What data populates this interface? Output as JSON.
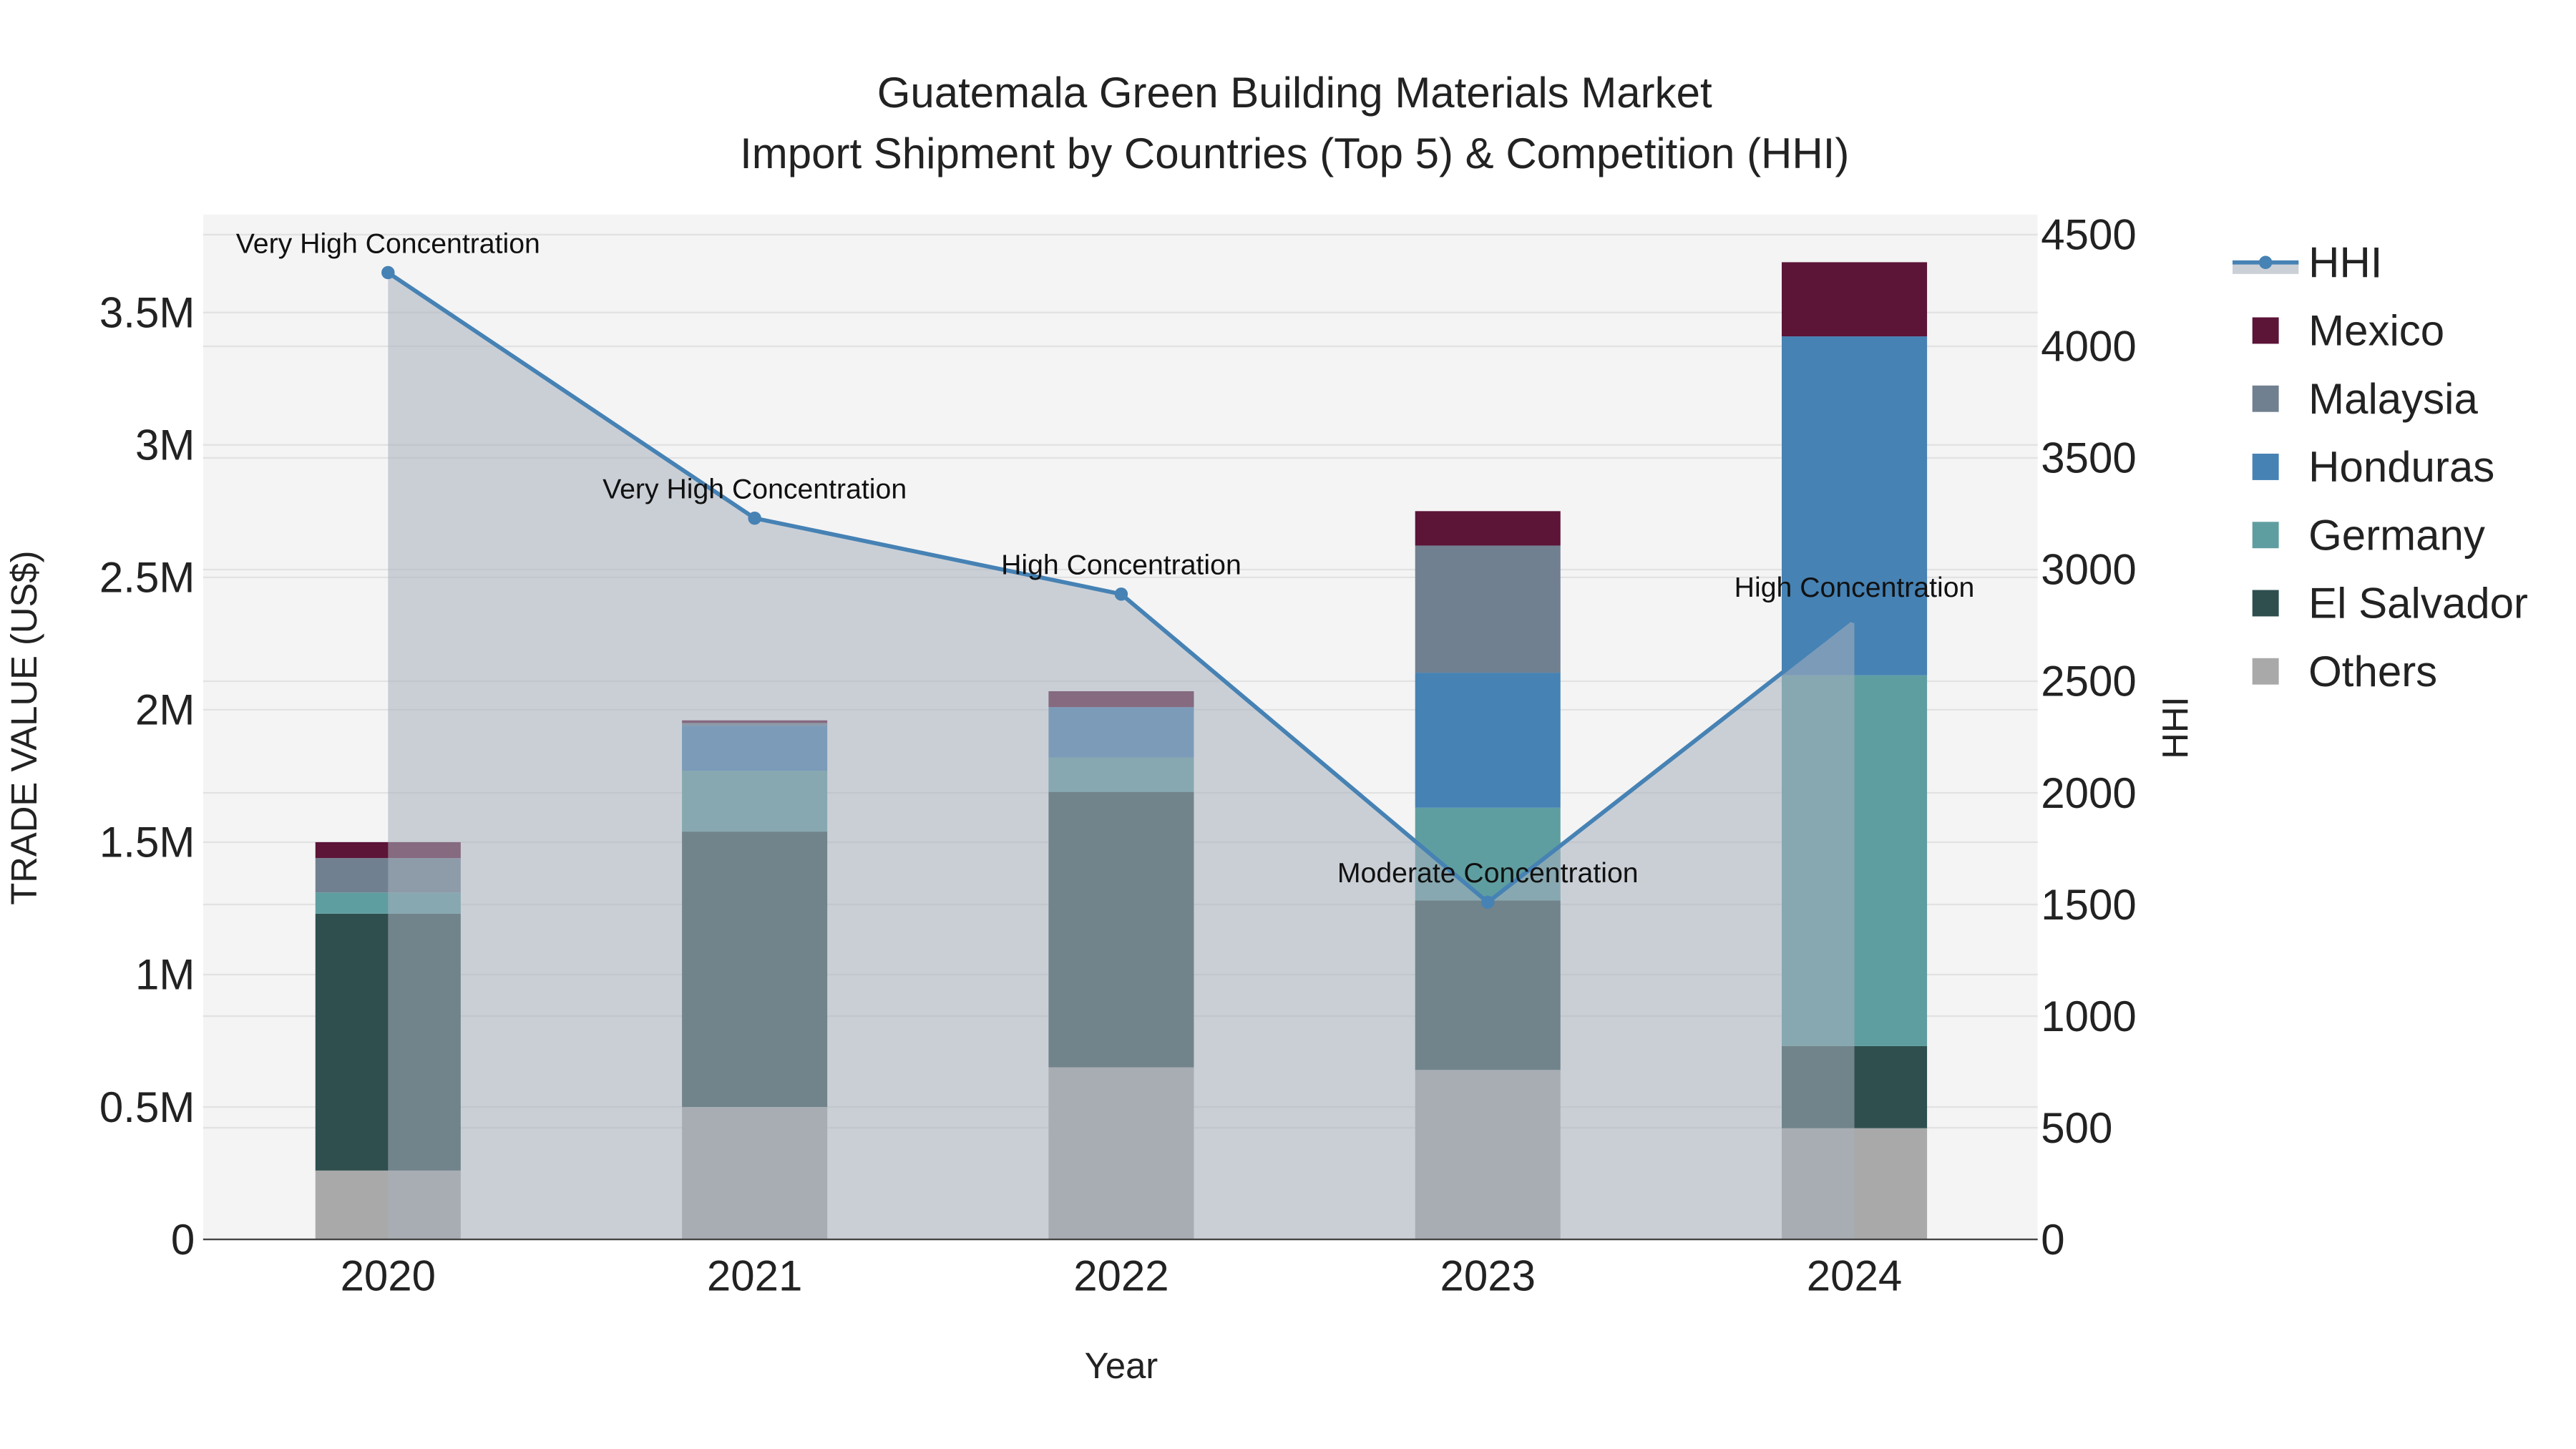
{
  "chart_data": {
    "type": "bar",
    "title": "Guatemala Green Building Materials Market",
    "subtitle": "Import Shipment by Countries (Top 5) & Competition (HHI)",
    "xlabel": "Year",
    "ylabel": "TRADE VALUE (US$)",
    "y2label": "HHI",
    "categories": [
      "2020",
      "2021",
      "2022",
      "2023",
      "2024"
    ],
    "ylim": [
      0,
      3870000
    ],
    "y2lim": [
      0,
      4590
    ],
    "yticks": [
      {
        "v": 0,
        "t": "0"
      },
      {
        "v": 500000,
        "t": "0.5M"
      },
      {
        "v": 1000000,
        "t": "1M"
      },
      {
        "v": 1500000,
        "t": "1.5M"
      },
      {
        "v": 2000000,
        "t": "2M"
      },
      {
        "v": 2500000,
        "t": "2.5M"
      },
      {
        "v": 3000000,
        "t": "3M"
      },
      {
        "v": 3500000,
        "t": "3.5M"
      }
    ],
    "y2ticks": [
      {
        "v": 0,
        "t": "0"
      },
      {
        "v": 500,
        "t": "500"
      },
      {
        "v": 1000,
        "t": "1000"
      },
      {
        "v": 1500,
        "t": "1500"
      },
      {
        "v": 2000,
        "t": "2000"
      },
      {
        "v": 2500,
        "t": "2500"
      },
      {
        "v": 3000,
        "t": "3000"
      },
      {
        "v": 3500,
        "t": "3500"
      },
      {
        "v": 4000,
        "t": "4000"
      },
      {
        "v": 4500,
        "t": "4500"
      }
    ],
    "series": [
      {
        "name": "Others",
        "color": "#a9a9a9",
        "values": [
          260000,
          500000,
          650000,
          640000,
          420000
        ]
      },
      {
        "name": "El Salvador",
        "color": "#2f4f4f",
        "values": [
          970000,
          1040000,
          1040000,
          640000,
          310000
        ]
      },
      {
        "name": "Germany",
        "color": "#5f9ea0",
        "values": [
          80000,
          230000,
          130000,
          350000,
          1400000
        ]
      },
      {
        "name": "Honduras",
        "color": "#4682b4",
        "values": [
          0,
          170000,
          190000,
          510000,
          1280000
        ]
      },
      {
        "name": "Malaysia",
        "color": "#708090",
        "values": [
          130000,
          10000,
          0,
          480000,
          0
        ]
      },
      {
        "name": "Mexico",
        "color": "#5c1437",
        "values": [
          60000,
          10000,
          60000,
          130000,
          280000
        ]
      }
    ],
    "hhi": {
      "name": "HHI",
      "color": "#4682b4",
      "values": [
        4330,
        3230,
        2890,
        1510,
        2790
      ],
      "labels": [
        "Very High Concentration",
        "Very High Concentration",
        "High Concentration",
        "Moderate Concentration",
        "High Concentration"
      ]
    },
    "legend_order": [
      "HHI",
      "Mexico",
      "Malaysia",
      "Honduras",
      "Germany",
      "El Salvador",
      "Others"
    ],
    "legend_position": "right",
    "grid": true
  }
}
